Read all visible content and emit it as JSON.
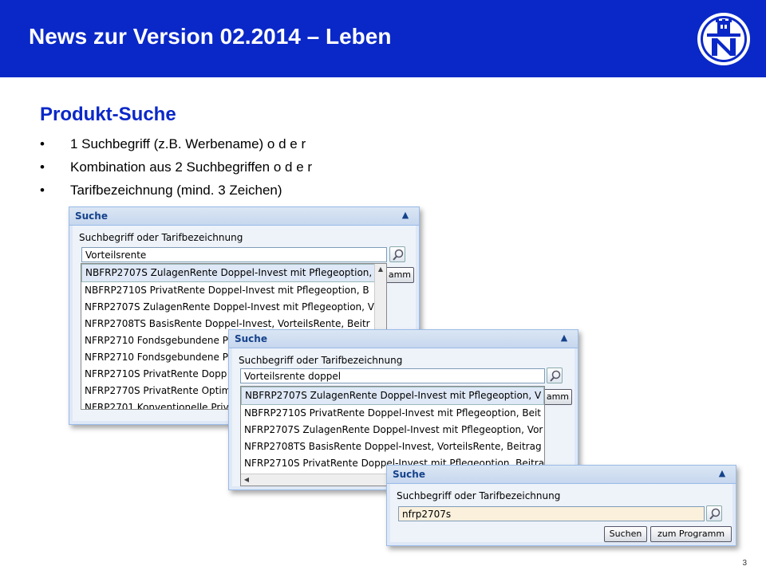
{
  "header": {
    "title": "News zur Version 02.2014 – Leben",
    "logo_icon": "nuernberger-logo"
  },
  "section_title": "Produkt-Suche",
  "bullets": [
    "1 Suchbegriff (z.B. Werbename)  o d e r",
    "Kombination aus 2 Suchbegriffen  o d e r",
    "Tarifbezeichnung (mind. 3 Zeichen)"
  ],
  "bullet_symbol": "•",
  "page_number": "3",
  "panel1": {
    "title": "Suche",
    "label": "Suchbegriff oder Tarifbezeichnung",
    "input": "Vorteilsrente",
    "button_partial": "amm",
    "items": [
      "NBFRP2707S ZulagenRente Doppel-Invest mit Pflegeoption,",
      "NBFRP2710S PrivatRente Doppel-Invest mit Pflegeoption, B",
      "NFRP2707S ZulagenRente Doppel-Invest mit Pflegeoption, V",
      "NFRP2708TS BasisRente Doppel-Invest, VorteilsRente, Beitr",
      "NFRP2710 Fondsgebundene P",
      "NFRP2710 Fondsgebundene P",
      "NFRP2710S PrivatRente Dopp",
      "NFRP2770S PrivatRente Optim",
      "NFRP2701 Konventionelle Privat"
    ]
  },
  "panel2": {
    "title": "Suche",
    "label": "Suchbegriff oder Tarifbezeichnung",
    "input": "Vorteilsrente doppel",
    "button_partial": "amm",
    "items": [
      "NBFRP2707S ZulagenRente Doppel-Invest mit Pflegeoption, V",
      "NBFRP2710S PrivatRente Doppel-Invest mit Pflegeoption, Beit",
      "NFRP2707S ZulagenRente Doppel-Invest mit Pflegeoption, Vor",
      "NFRP2708TS BasisRente Doppel-Invest, VorteilsRente, Beitrag",
      "NFRP2710S PrivatRente Doppel-Invest mit Pflegeoption. Beitra"
    ]
  },
  "panel3": {
    "title": "Suche",
    "label": "Suchbegriff oder Tarifbezeichnung",
    "input": "nfrp2707s",
    "search_label": "Suchen",
    "program_label": "zum Programm"
  }
}
